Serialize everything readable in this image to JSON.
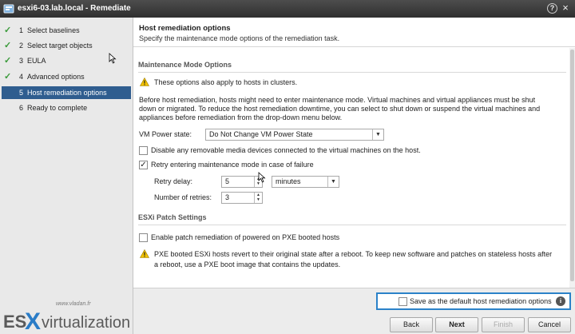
{
  "window": {
    "title": "esxi6-03.lab.local - Remediate",
    "help_label": "?",
    "close_label": "×"
  },
  "steps": [
    {
      "num": "1",
      "label": "Select baselines",
      "done": true
    },
    {
      "num": "2",
      "label": "Select target objects",
      "done": true
    },
    {
      "num": "3",
      "label": "EULA",
      "done": true
    },
    {
      "num": "4",
      "label": "Advanced options",
      "done": true
    },
    {
      "num": "5",
      "label": "Host remediation options",
      "done": false,
      "active": true
    },
    {
      "num": "6",
      "label": "Ready to complete",
      "done": false
    }
  ],
  "header": {
    "title": "Host remediation options",
    "subtitle": "Specify the maintenance mode options of the remediation task."
  },
  "maintenance": {
    "section_title": "Maintenance Mode Options",
    "warning": "These options also apply to hosts in clusters.",
    "description": [
      "Before host remediation, hosts might need to enter maintenance mode. Virtual machines and virtual appliances must be shut",
      "down or migrated. To reduce the host remediation downtime, you can select to shut down or suspend the virtual machines and",
      "appliances before remediation from the drop-down menu below."
    ],
    "vm_power_label": "VM Power state:",
    "vm_power_value": "Do Not Change VM Power State",
    "disable_media_label": "Disable any removable media devices connected to the virtual machines on the host.",
    "disable_media_checked": false,
    "retry_label": "Retry entering maintenance mode in case of failure",
    "retry_checked": true,
    "retry_delay_label": "Retry delay:",
    "retry_delay_value": "5",
    "retry_delay_unit": "minutes",
    "retries_label": "Number of retries:",
    "retries_value": "3"
  },
  "patch": {
    "section_title": "ESXi Patch Settings",
    "pxe_label": "Enable patch remediation of powered on PXE booted hosts",
    "pxe_checked": false,
    "warning": [
      "PXE booted ESXi hosts revert to their original state after a reboot. To keep new software and patches on stateless hosts after",
      "a reboot, use a PXE boot image that contains the updates."
    ]
  },
  "footer": {
    "save_default_label": "Save as the default host remediation options",
    "save_default_checked": false,
    "info_label": "i",
    "back_label": "Back",
    "next_label": "Next",
    "finish_label": "Finish",
    "cancel_label": "Cancel"
  },
  "watermark": {
    "url": "www.vladan.fr",
    "brand": "ESXvirtualization"
  },
  "colors": {
    "active_step": "#2f5d8f",
    "check": "#3a9a3a",
    "highlight_border": "#2b82c9",
    "warning": "#f2c200"
  }
}
